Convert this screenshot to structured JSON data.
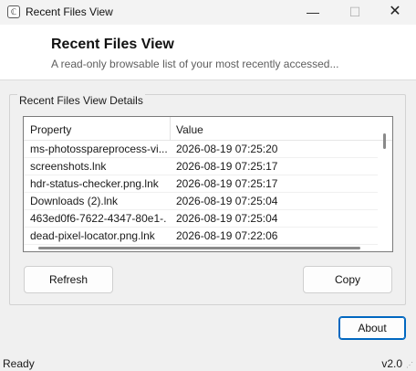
{
  "window": {
    "title": "Recent Files View",
    "icon": "app-icon",
    "controls": {
      "minimize": "—",
      "maximize": "☐",
      "close": "✕"
    }
  },
  "header": {
    "title": "Recent Files View",
    "subtitle": "A read-only browsable list of your most recently accessed..."
  },
  "group": {
    "label": "Recent Files View Details",
    "columns": [
      "Property",
      "Value"
    ],
    "rows": [
      {
        "property": "ms-photosspareprocess-vi...",
        "value": "2026-08-19 07:25:20"
      },
      {
        "property": "screenshots.lnk",
        "value": "2026-08-19 07:25:17"
      },
      {
        "property": "hdr-status-checker.png.lnk",
        "value": "2026-08-19 07:25:17"
      },
      {
        "property": "Downloads (2).lnk",
        "value": "2026-08-19 07:25:04"
      },
      {
        "property": "463ed0f6-7622-4347-80e1-...",
        "value": "2026-08-19 07:25:04"
      },
      {
        "property": "dead-pixel-locator.png.lnk",
        "value": "2026-08-19 07:22:06"
      }
    ]
  },
  "buttons": {
    "refresh": "Refresh",
    "copy": "Copy",
    "about": "About"
  },
  "status": {
    "text": "Ready",
    "version": "v2.0"
  },
  "colors": {
    "accent": "#0067c0",
    "background": "#f0f0f0",
    "header_bg": "#ffffff"
  }
}
